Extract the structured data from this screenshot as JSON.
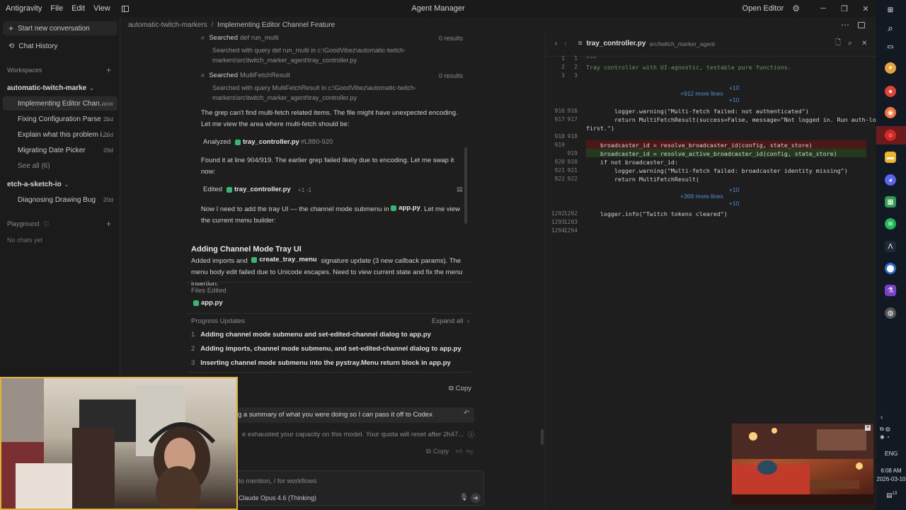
{
  "titlebar": {
    "app_name": "Antigravity",
    "menu": [
      "File",
      "Edit",
      "View"
    ],
    "title": "Agent Manager",
    "open_editor": "Open Editor"
  },
  "sidebar": {
    "new_conversation": "Start new conversation",
    "chat_history": "Chat History",
    "workspaces_label": "Workspaces",
    "workspaces": [
      {
        "name": "automatic-twitch-marke",
        "chats": [
          {
            "title": "Implementing Editor Chan...",
            "time": "now"
          },
          {
            "title": "Fixing Configuration Parse ...",
            "time": "26d"
          },
          {
            "title": "Explain what this problem i...",
            "time": "26d"
          },
          {
            "title": "Migrating Date Picker",
            "time": "29d"
          }
        ],
        "see_all": "See all (6)"
      },
      {
        "name": "etch-a-sketch-io",
        "chats": [
          {
            "title": "Diagnosing Drawing Bug",
            "time": "20d"
          }
        ]
      }
    ],
    "playground_label": "Playground",
    "no_chats": "No chats yet"
  },
  "chat": {
    "breadcrumb_root": "automatic-twitch-markers",
    "breadcrumb_sep": "/",
    "breadcrumb_current": "Implementing Editor Channel Feature",
    "search1_label": "Searched",
    "search1_query": "def run_multi",
    "search1_results": "0 results",
    "search1_detail": "Searched with query def run_multi in c:\\GoodVibez\\automatic-twitch-markers\\src\\twitch_marker_agent\\tray_controller.py",
    "search2_label": "Searched",
    "search2_query": "MultiFetchResult",
    "search2_results": "0 results",
    "search2_detail": "Searched with query MultiFetchResult in c:\\GoodVibez\\automatic-twitch-markers\\src\\twitch_marker_agent\\tray_controller.py",
    "msg1": "The grep can't find multi-fetch related items. The file might have unexpected encoding. Let me view the area where multi-fetch should be:",
    "analyzed_label": "Analyzed",
    "analyzed_file": "tray_controller.py",
    "analyzed_range": "#L880-920",
    "msg2": "Found it at line 904/919. The earlier grep failed likely due to encoding. Let me swap it now:",
    "edited_label": "Edited",
    "edited_file": "tray_controller.py",
    "edited_diff": "+1 -1",
    "msg3_a": "Now I need to add the tray UI — the channel mode submenu in",
    "msg3_file": "app.py",
    "msg3_b": ". Let me view the current menu builder:",
    "section_title": "Adding Channel Mode Tray UI",
    "section_a": "Added imports and",
    "section_fn": "create_tray_menu",
    "section_b": "signature update (3 new callback params). The menu body edit failed due to Unicode escapes. Need to view current state and fix the menu insertion.",
    "files_edited_label": "Files Edited",
    "files_edited": "app.py",
    "progress_label": "Progress Updates",
    "expand_all": "Expand all",
    "progress": [
      {
        "n": "1",
        "text": "Adding channel mode submenu and set-edited-channel dialog to app.py"
      },
      {
        "n": "2",
        "text": "Adding imports, channel mode submenu, and set-edited-channel dialog to app.py"
      },
      {
        "n": "3",
        "text": "Inserting channel mode submenu into the pystray.Menu return block in app.py"
      }
    ],
    "copy": "Copy",
    "user_msg": "g a summary of what you were doing so I can pass it off to Codex",
    "error_msg": "e exhausted your capacity on this model. Your quota will reset after 2h47...",
    "copy2": "Copy",
    "input_placeholder": "to mention, / for workflows",
    "model": "Claude Opus 4.6 (Thinking)"
  },
  "editor": {
    "filename": "tray_controller.py",
    "path": "src/twitch_marker_agent",
    "fold1": "+912 more lines",
    "fold2": "+369 more lines",
    "plus10": "+10",
    "lines": [
      {
        "a": "1",
        "b": "1",
        "code": "\"\"\""
      },
      {
        "a": "2",
        "b": "2",
        "code": "Tray controller with UI-agnostic, testable pure functions."
      },
      {
        "a": "3",
        "b": "3",
        "code": ""
      },
      {
        "a": "916",
        "b": "916",
        "code": "        logger.warning(\"Multi-fetch failed: not authenticated\")"
      },
      {
        "a": "917",
        "b": "917",
        "code": "        return MultiFetchResult(success=False, message=\"Not logged in. Run auth-login"
      },
      {
        "a": "",
        "b": "",
        "code": "first.\")"
      },
      {
        "a": "918",
        "b": "918",
        "code": ""
      },
      {
        "a": "919",
        "b": "",
        "code": "    broadcaster_id = resolve_broadcaster_id(config, state_store)"
      },
      {
        "a": "",
        "b": "919",
        "code": "    broadcaster_id = resolve_active_broadcaster_id(config, state_store)"
      },
      {
        "a": "920",
        "b": "920",
        "code": "    if not broadcaster_id:"
      },
      {
        "a": "921",
        "b": "921",
        "code": "        logger.warning(\"Multi-fetch failed: broadcaster identity missing\")"
      },
      {
        "a": "922",
        "b": "922",
        "code": "        return MultiFetchResult("
      },
      {
        "a": "1292",
        "b": "1292",
        "code": "    logger.info(\"Twitch tokens cleared\")"
      },
      {
        "a": "1293",
        "b": "1293",
        "code": ""
      },
      {
        "a": "1294",
        "b": "1294",
        "code": ""
      }
    ]
  },
  "taskbar": {
    "lang": "ENG",
    "time": "6:08 AM",
    "date": "2026-03-10",
    "notif": "13"
  },
  "colors": {
    "accent_blue": "#4f8fd6",
    "diff_del": "#4b1818",
    "diff_add": "#233a1f",
    "python_green": "#3bb371"
  }
}
